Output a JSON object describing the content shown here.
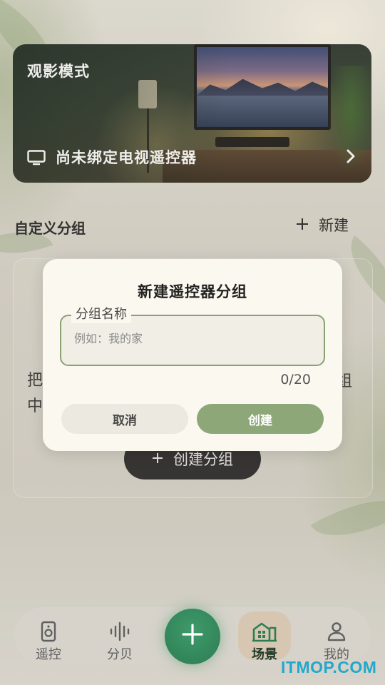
{
  "hero": {
    "title": "观影模式",
    "status": "尚未绑定电视遥控器",
    "icon": "tv-icon"
  },
  "section": {
    "title": "自定义分组",
    "new_label": "新建"
  },
  "empty_state": {
    "line1_start": "把",
    "line1_end": "组",
    "line2_start": "中",
    "create_button": "创建分组"
  },
  "dialog": {
    "title": "新建遥控器分组",
    "field_label": "分组名称",
    "field_placeholder": "例如：我的家",
    "field_value": "",
    "counter": "0/20",
    "cancel": "取消",
    "confirm": "创建"
  },
  "nav": {
    "items": [
      {
        "label": "遥控",
        "icon": "remote-icon"
      },
      {
        "label": "分贝",
        "icon": "sound-wave-icon"
      },
      {
        "label": "场景",
        "icon": "scene-home-icon",
        "active": true
      },
      {
        "label": "我的",
        "icon": "user-icon"
      }
    ],
    "fab_icon": "plus-icon"
  },
  "watermark": "ITMOP.COM",
  "colors": {
    "accent_green": "#2c7d52",
    "dialog_button": "#8ea778",
    "field_border": "#8aa173",
    "watermark": "#22a8cc"
  }
}
